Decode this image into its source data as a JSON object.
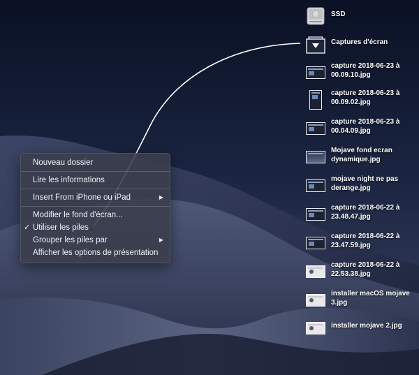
{
  "desktop_icons": [
    {
      "name": "SSD",
      "icon": "hard-drive-icon"
    },
    {
      "name": "Captures d'écran",
      "icon": "folder-stack-icon"
    },
    {
      "name": "capture 2018-06-23 à 00.09.10.jpg",
      "icon": "screenshot-thumbnail-icon"
    },
    {
      "name": "capture 2018-06-23 à 00.09.02.jpg",
      "icon": "screenshot-thumbnail-icon"
    },
    {
      "name": "capture 2018-06-23 à 00.04.09.jpg",
      "icon": "screenshot-thumbnail-icon"
    },
    {
      "name": "Mojave fond ecran dynamique.jpg",
      "icon": "screenshot-thumbnail-icon"
    },
    {
      "name": "mojave night ne pas derange.jpg",
      "icon": "screenshot-thumbnail-icon"
    },
    {
      "name": "capture 2018-06-22 à 23.48.47.jpg",
      "icon": "screenshot-thumbnail-icon"
    },
    {
      "name": "capture 2018-06-22 à 23.47.59.jpg",
      "icon": "screenshot-thumbnail-icon"
    },
    {
      "name": "capture 2018-06-22 à 22.53.38.jpg",
      "icon": "screenshot-thumbnail-icon"
    },
    {
      "name": "installer macOS mojave 3.jpg",
      "icon": "screenshot-thumbnail-icon"
    },
    {
      "name": "installer mojave 2.jpg",
      "icon": "screenshot-thumbnail-icon"
    }
  ],
  "context_menu": {
    "items": [
      {
        "label": "Nouveau dossier"
      },
      {
        "label": "Lire les informations"
      },
      {
        "label": "Insert From iPhone ou iPad",
        "submenu": true
      },
      {
        "label": "Modifier le fond d'écran..."
      },
      {
        "label": "Utiliser les piles",
        "checked": true,
        "check_mark": "✓"
      },
      {
        "label": "Grouper les piles par",
        "submenu": true
      },
      {
        "label": "Afficher les options de présentation"
      }
    ],
    "submenu_glyph": "▶"
  },
  "colors": {
    "menu_bg": "#3a3e4c",
    "menu_text": "#f2f3f6",
    "sky_top": "#0c1326",
    "dune_dark": "#1c2336"
  }
}
